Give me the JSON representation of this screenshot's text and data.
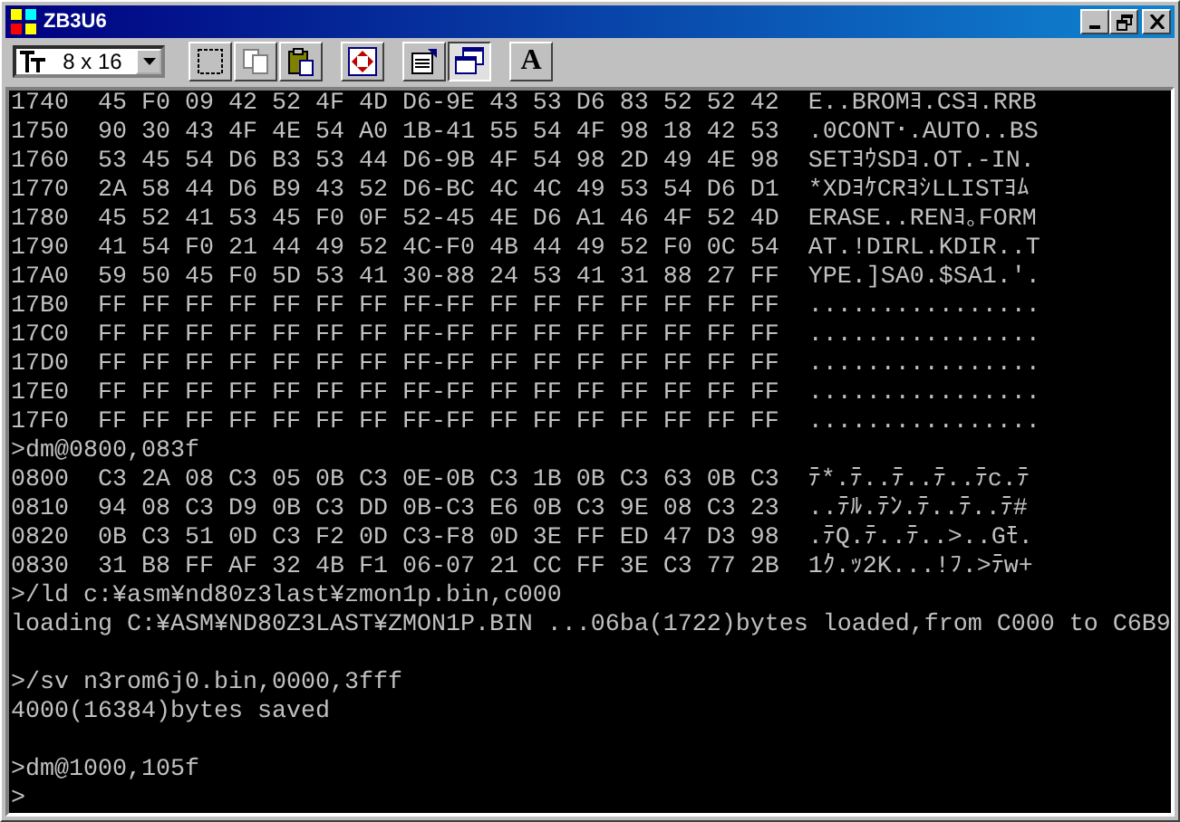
{
  "window": {
    "title": "ZB3U6"
  },
  "toolbar": {
    "font_size": "8 x 16",
    "buttons": [
      {
        "kind": "mark",
        "pressed": false
      },
      {
        "kind": "copy",
        "pressed": false
      },
      {
        "kind": "paste",
        "pressed": false
      },
      {
        "kind": "fullscreen",
        "pressed": false
      },
      {
        "kind": "properties",
        "pressed": false
      },
      {
        "kind": "background",
        "pressed": true
      },
      {
        "kind": "font",
        "label": "A",
        "pressed": false
      }
    ]
  },
  "console": {
    "lines": [
      {
        "kind": "text",
        "text": "1740  45 F0 09 42 52 4F 4D D6-9E 43 53 D6 83 52 52 42  E..BROMﾖ.CSﾖ.RRB"
      },
      {
        "kind": "text",
        "text": "1750  90 30 43 4F 4E 54 A0 1B-41 55 54 4F 98 18 42 53  .0CONT･.AUTO..BS"
      },
      {
        "kind": "text",
        "text": "1760  53 45 54 D6 B3 53 44 D6-9B 4F 54 98 2D 49 4E 98  SETﾖｳSDﾖ.OT.-IN."
      },
      {
        "kind": "text",
        "text": "1770  2A 58 44 D6 B9 43 52 D6-BC 4C 4C 49 53 54 D6 D1  *XDﾖｹCRﾖｼLLISTﾖﾑ"
      },
      {
        "kind": "text",
        "text": "1780  45 52 41 53 45 F0 0F 52-45 4E D6 A1 46 4F 52 4D  ERASE..RENﾖ｡FORM"
      },
      {
        "kind": "text",
        "text": "1790  41 54 F0 21 44 49 52 4C-F0 4B 44 49 52 F0 0C 54  AT.!DIRL.KDIR..T"
      },
      {
        "kind": "text",
        "text": "17A0  59 50 45 F0 5D 53 41 30-88 24 53 41 31 88 27 FF  YPE.]SA0.$SA1.'."
      },
      {
        "kind": "text",
        "text": "17B0  FF FF FF FF FF FF FF FF-FF FF FF FF FF FF FF FF  ................"
      },
      {
        "kind": "text",
        "text": "17C0  FF FF FF FF FF FF FF FF-FF FF FF FF FF FF FF FF  ................"
      },
      {
        "kind": "text",
        "text": "17D0  FF FF FF FF FF FF FF FF-FF FF FF FF FF FF FF FF  ................"
      },
      {
        "kind": "text",
        "text": "17E0  FF FF FF FF FF FF FF FF-FF FF FF FF FF FF FF FF  ................"
      },
      {
        "kind": "text",
        "text": "17F0  FF FF FF FF FF FF FF FF-FF FF FF FF FF FF FF FF  ................"
      },
      {
        "kind": "text",
        "text": ">dm@0800,083f"
      },
      {
        "kind": "text",
        "text": "0800  C3 2A 08 C3 05 0B C3 0E-0B C3 1B 0B C3 63 0B C3  ﾃ*.ﾃ..ﾃ..ﾃ..ﾃc.ﾃ"
      },
      {
        "kind": "text",
        "text": "0810  94 08 C3 D9 0B C3 DD 0B-C3 E6 0B C3 9E 08 C3 23  ..ﾃﾙ.ﾃﾝ.ﾃ..ﾃ..ﾃ#"
      },
      {
        "kind": "text",
        "text": "0820  0B C3 51 0D C3 F2 0D C3-F8 0D 3E FF ED 47 D3 98  .ﾃQ.ﾃ..ﾃ..>..Gﾓ."
      },
      {
        "kind": "text",
        "text": "0830  31 B8 FF AF 32 4B F1 06-07 21 CC FF 3E C3 77 2B  1ｸ.ｯ2K...!ﾌ.>ﾃw+"
      },
      {
        "kind": "text",
        "text": ">/ld c:¥asm¥nd80z3last¥zmon1p.bin,c000"
      },
      {
        "kind": "text",
        "text": "loading C:¥ASM¥ND80Z3LAST¥ZMON1P.BIN ...06ba(1722)bytes loaded,from C000 to C6B9"
      },
      {
        "kind": "blank"
      },
      {
        "kind": "text",
        "text": ">/sv n3rom6j0.bin,0000,3fff"
      },
      {
        "kind": "text",
        "text": "4000(16384)bytes saved"
      },
      {
        "kind": "blank"
      },
      {
        "kind": "text",
        "text": ">dm@1000,105f"
      },
      {
        "kind": "text",
        "text": ">"
      }
    ]
  }
}
